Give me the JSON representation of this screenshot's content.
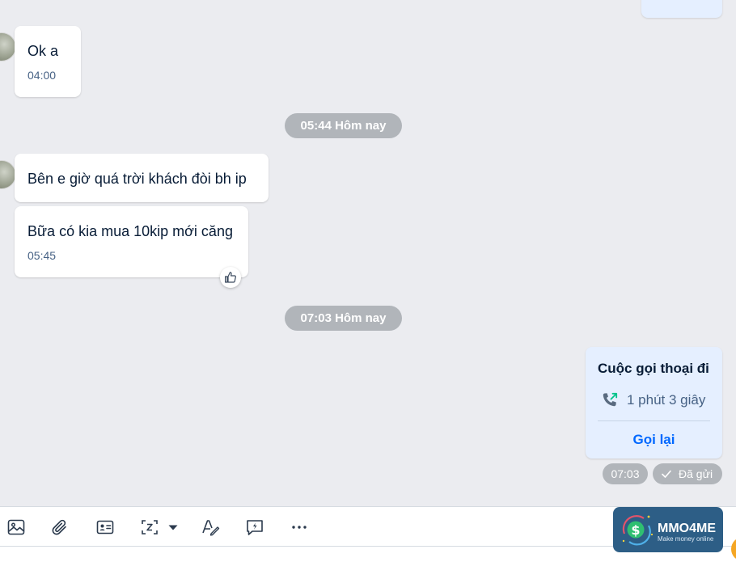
{
  "messages": [
    {
      "text": "Ok a",
      "time": "04:00"
    },
    {
      "text": "Bên e giờ quá trời khách đòi bh ip"
    },
    {
      "text": "Bữa có kia mua 10kip mới căng",
      "time": "05:45"
    }
  ],
  "date_separators": [
    "05:44 Hôm nay",
    "07:03 Hôm nay"
  ],
  "call": {
    "title": "Cuộc gọi thoại đi",
    "duration": "1 phút 3 giây",
    "action": "Gọi lại",
    "time": "07:03",
    "status": "Đã gửi"
  },
  "toolbar_icons": [
    "image-icon",
    "attachment-icon",
    "contact-card-icon",
    "screenshot-icon",
    "dropdown-caret-icon",
    "text-format-icon",
    "quick-message-icon",
    "more-icon"
  ],
  "logo": {
    "name": "MMO4ME",
    "tagline": "Make money online"
  },
  "colors": {
    "chat_bg": "#ebecf0",
    "accent": "#0068ff",
    "own_bubble": "#e5efff",
    "chip": "#b1b5ba"
  }
}
